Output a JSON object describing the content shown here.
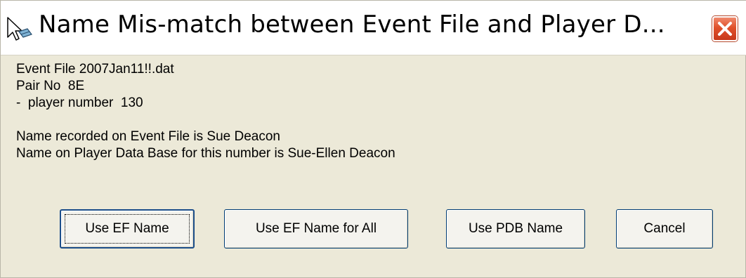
{
  "dialog": {
    "title": "Name Mis-match between Event File and Player D...",
    "close_icon": "close-icon",
    "title_icon": "app-icon"
  },
  "message": {
    "event_file": "Event File 2007Jan11!!.dat",
    "pair_no": "Pair No  8E",
    "player_number": "-  player number  130",
    "ef_name": "Name recorded on Event File is Sue Deacon",
    "pdb_name": "Name on Player Data Base for this number is Sue-Ellen Deacon"
  },
  "buttons": {
    "use_ef_name": "Use EF Name",
    "use_ef_name_all": "Use EF Name for All",
    "use_pdb_name": "Use PDB Name",
    "cancel": "Cancel"
  },
  "colors": {
    "dialog_bg": "#ece9d8",
    "close_button": "#e0502a",
    "button_border": "#003c74"
  }
}
